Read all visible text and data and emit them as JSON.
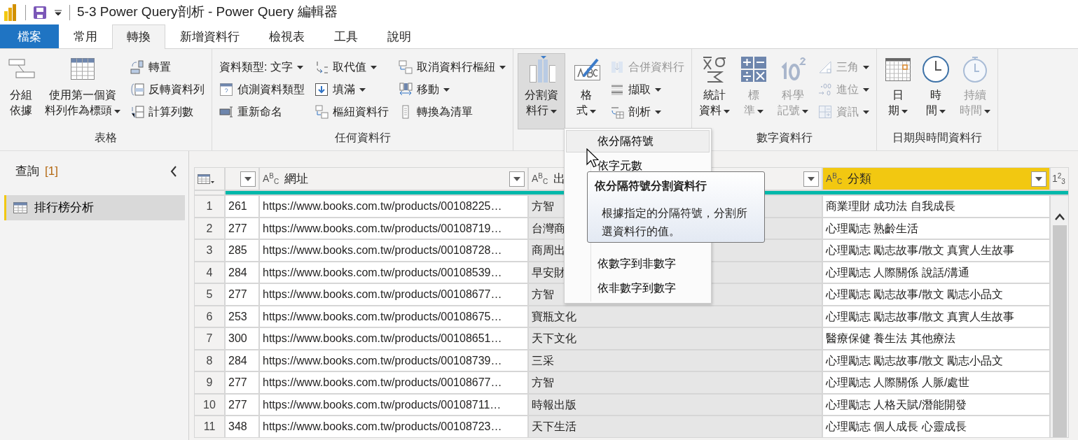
{
  "window": {
    "title": "5-3 Power Query剖析 - Power Query 編輯器"
  },
  "tabs": [
    {
      "label": "檔案",
      "kind": "file",
      "selected": false
    },
    {
      "label": "常用",
      "kind": "tab",
      "selected": false
    },
    {
      "label": "轉換",
      "kind": "tab",
      "selected": true
    },
    {
      "label": "新增資料行",
      "kind": "tab",
      "selected": false
    },
    {
      "label": "檢視表",
      "kind": "tab",
      "selected": false
    },
    {
      "label": "工具",
      "kind": "tab",
      "selected": false
    },
    {
      "label": "說明",
      "kind": "tab",
      "selected": false
    }
  ],
  "ribbon": [
    {
      "label": "表格",
      "items": [
        {
          "kind": "large",
          "label": "分組依據",
          "dropdown": false,
          "disabled": false,
          "pressed": false
        },
        {
          "kind": "large",
          "label": "使用第一個資料列作為標頭",
          "dropdown": true,
          "disabled": false,
          "pressed": false
        },
        {
          "kind": "stack",
          "buttons": [
            {
              "label": "轉置",
              "dropdown": false,
              "disabled": false
            },
            {
              "label": "反轉資料列",
              "dropdown": false,
              "disabled": false
            },
            {
              "label": "計算列數",
              "dropdown": false,
              "disabled": false
            }
          ]
        }
      ]
    },
    {
      "label": "任何資料行",
      "items": [
        {
          "kind": "stack",
          "buttons": [
            {
              "label": "資料類型: 文字",
              "dropdown": true,
              "disabled": false
            },
            {
              "label": "偵測資料類型",
              "dropdown": false,
              "disabled": false
            },
            {
              "label": "重新命名",
              "dropdown": false,
              "disabled": false
            }
          ]
        },
        {
          "kind": "stack",
          "buttons": [
            {
              "label": "取代值",
              "dropdown": true,
              "disabled": false
            },
            {
              "label": "填滿",
              "dropdown": true,
              "disabled": false
            },
            {
              "label": "樞紐資料行",
              "dropdown": false,
              "disabled": false
            }
          ]
        },
        {
          "kind": "stack",
          "buttons": [
            {
              "label": "取消資料行樞紐",
              "dropdown": true,
              "disabled": false
            },
            {
              "label": "移動",
              "dropdown": true,
              "disabled": false
            },
            {
              "label": "轉換為清單",
              "dropdown": false,
              "disabled": false
            }
          ]
        }
      ]
    },
    {
      "items": [
        {
          "kind": "large",
          "label": "分割資料行",
          "dropdown": true,
          "disabled": false,
          "pressed": true
        },
        {
          "kind": "large",
          "label": "格式",
          "dropdown": true,
          "disabled": false,
          "pressed": false
        },
        {
          "kind": "stack",
          "buttons": [
            {
              "label": "合併資料行",
              "dropdown": false,
              "disabled": true
            },
            {
              "label": "擷取",
              "dropdown": true,
              "disabled": false
            },
            {
              "label": "剖析",
              "dropdown": true,
              "disabled": false
            }
          ]
        }
      ]
    },
    {
      "label": "數字資料行",
      "items": [
        {
          "kind": "large",
          "label": "統計資料",
          "dropdown": true,
          "disabled": false,
          "pressed": false
        },
        {
          "kind": "large",
          "label": "標準",
          "dropdown": true,
          "disabled": true,
          "pressed": false
        },
        {
          "kind": "large",
          "label": "科學記號",
          "dropdown": true,
          "disabled": true,
          "pressed": false
        },
        {
          "kind": "stack",
          "buttons": [
            {
              "label": "三角",
              "dropdown": true,
              "disabled": true
            },
            {
              "label": "進位",
              "dropdown": true,
              "disabled": true
            },
            {
              "label": "資訊",
              "dropdown": true,
              "disabled": true
            }
          ]
        }
      ]
    },
    {
      "label": "日期與時間資料行",
      "items": [
        {
          "kind": "large",
          "label": "日期",
          "dropdown": true,
          "disabled": false,
          "pressed": false
        },
        {
          "kind": "large",
          "label": "時間",
          "dropdown": true,
          "disabled": false,
          "pressed": false
        },
        {
          "kind": "large",
          "label": "持續時間",
          "dropdown": true,
          "disabled": true,
          "pressed": false
        }
      ]
    }
  ],
  "queries": {
    "title": "查詢",
    "count": "[1]",
    "items": [
      {
        "label": "排行榜分析",
        "selected": true
      }
    ]
  },
  "table": {
    "columns": [
      {
        "kind": "number",
        "selected": false
      },
      {
        "kind": "text",
        "type_label": "A$^{B}$$_{C}$",
        "title": "網址",
        "selected": false
      },
      {
        "kind": "text",
        "type_label": "A$^{B}$$_{C}$",
        "title": "出",
        "selected": false
      },
      {
        "kind": "text",
        "type_label": "A$^{B}$$_{C}$",
        "title": "分類",
        "selected": true
      },
      {
        "kind": "partial",
        "type_label": "1$^{2}$$_{3}$",
        "selected": false
      }
    ],
    "rows": [
      {
        "index": "1",
        "values": [
          "261",
          "https://www.books.com.tw/products/00108225…",
          "方智",
          "商業理財 成功法 自我成長"
        ]
      },
      {
        "index": "2",
        "values": [
          "277",
          "https://www.books.com.tw/products/00108719…",
          "台灣商",
          "心理勵志 熟齡生活"
        ]
      },
      {
        "index": "3",
        "values": [
          "285",
          "https://www.books.com.tw/products/00108728…",
          "商周出",
          "心理勵志 勵志故事/散文 真實人生故事"
        ]
      },
      {
        "index": "4",
        "values": [
          "284",
          "https://www.books.com.tw/products/00108539…",
          "早安財",
          "心理勵志 人際關係 說話/溝通"
        ]
      },
      {
        "index": "5",
        "values": [
          "277",
          "https://www.books.com.tw/products/00108677…",
          "方智",
          "心理勵志 勵志故事/散文 勵志小品文"
        ]
      },
      {
        "index": "6",
        "values": [
          "253",
          "https://www.books.com.tw/products/00108675…",
          "寶瓶文化",
          "心理勵志 勵志故事/散文 真實人生故事"
        ]
      },
      {
        "index": "7",
        "values": [
          "300",
          "https://www.books.com.tw/products/00108651…",
          "天下文化",
          "醫療保健 養生法 其他療法"
        ]
      },
      {
        "index": "8",
        "values": [
          "284",
          "https://www.books.com.tw/products/00108739…",
          "三采",
          "心理勵志 勵志故事/散文 勵志小品文"
        ]
      },
      {
        "index": "9",
        "values": [
          "277",
          "https://www.books.com.tw/products/00108677…",
          "方智",
          "心理勵志 人際關係 人脈/處世"
        ]
      },
      {
        "index": "10",
        "values": [
          "277",
          "https://www.books.com.tw/products/00108711…",
          "時報出版",
          "心理勵志 人格天賦/潛能開發"
        ]
      },
      {
        "index": "11",
        "values": [
          "348",
          "https://www.books.com.tw/products/00108723…",
          "天下生活",
          "心理勵志 個人成長 心靈成長"
        ]
      }
    ]
  },
  "split_menu": {
    "items": [
      {
        "label": "依分隔符號",
        "selected": true
      },
      {
        "label": "依字元數",
        "selected": false
      },
      {
        "label": "依數字到非數字",
        "selected": false
      },
      {
        "label": "依非數字到數字",
        "selected": false
      }
    ]
  },
  "tooltip": {
    "title": "依分隔符號分割資料行",
    "text": "根據指定的分隔符號，分割所選資料行的值。"
  }
}
